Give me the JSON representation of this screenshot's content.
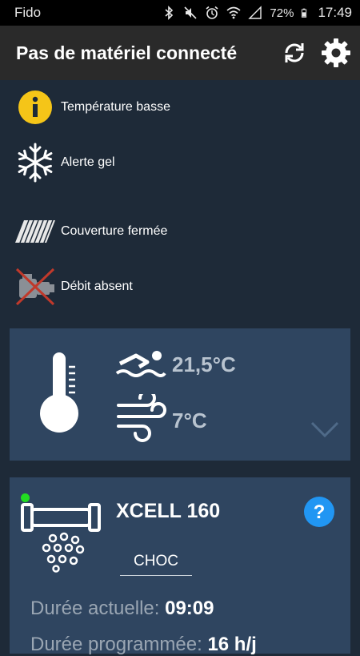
{
  "status_bar": {
    "carrier": "Fido",
    "battery": "72%",
    "time": "17:49"
  },
  "app_bar": {
    "title": "Pas de matériel connecté",
    "refresh_icon": "refresh-icon",
    "settings_icon": "gear-icon"
  },
  "alerts": [
    {
      "label": "Température basse",
      "icon": "info-icon",
      "color": "#f5c518"
    },
    {
      "label": "Alerte gel",
      "icon": "snowflake-icon"
    },
    {
      "label": "Couverture fermée",
      "icon": "pool-cover-icon"
    },
    {
      "label": "Débit absent",
      "icon": "flow-absent-icon"
    }
  ],
  "temperature_card": {
    "water_temp": "21,5°C",
    "air_temp": "7°C",
    "expand_icon": "chevron-down-icon"
  },
  "device_card": {
    "name": "XCELL 160",
    "mode": "CHOC",
    "status_color": "#22dd22",
    "current_duration_label": "Durée actuelle:",
    "current_duration_value": "09:09",
    "programmed_duration_label": "Durée programmée:",
    "programmed_duration_value": "16 h/j",
    "help_icon": "help-icon"
  },
  "colors": {
    "background": "#1e2a38",
    "card": "#2f4560",
    "help_blue": "#2196f3"
  }
}
